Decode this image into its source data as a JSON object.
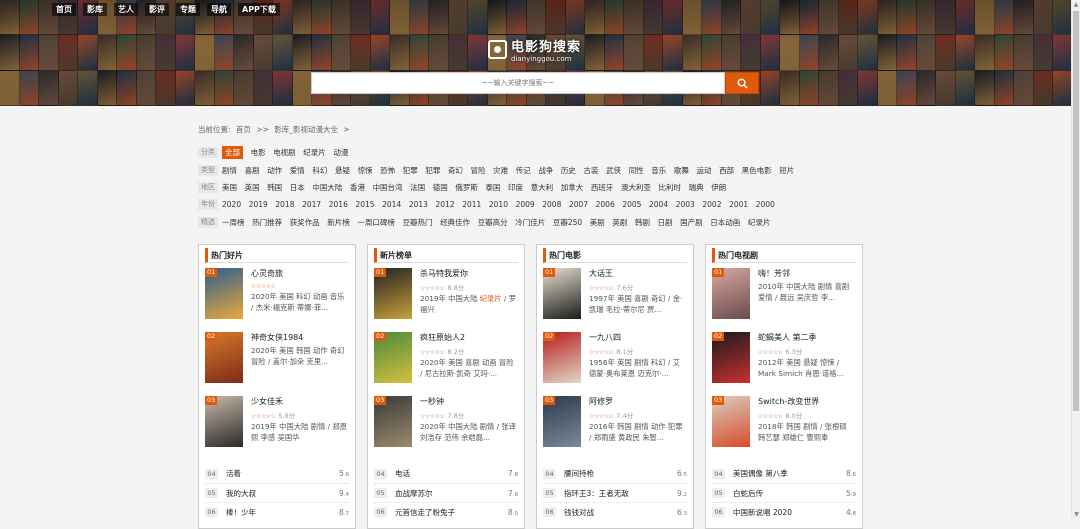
{
  "nav": [
    "首页",
    "影库",
    "艺人",
    "影评",
    "专题",
    "导航",
    "APP下载"
  ],
  "logo": {
    "title": "电影狗搜索",
    "subtitle": "dianyinggou.com"
  },
  "search": {
    "placeholder": "~~输入关键字搜索~~"
  },
  "colors": {
    "accent": "#e05a0c"
  },
  "breadcrumb": {
    "prefix": "当前位置:",
    "home": "首页",
    "sep1": ">>",
    "section": "影库_影视动漫大全",
    "sep2": ">"
  },
  "filters": [
    {
      "label": "分类",
      "items": [
        "全部",
        "电影",
        "电视剧",
        "纪录片",
        "动漫"
      ],
      "active": 0
    },
    {
      "label": "类型",
      "items": [
        "剧情",
        "喜剧",
        "动作",
        "爱情",
        "科幻",
        "悬疑",
        "惊悚",
        "恐怖",
        "犯罪",
        "犯罪",
        "奇幻",
        "冒险",
        "灾难",
        "传记",
        "战争",
        "历史",
        "古装",
        "武侠",
        "同性",
        "音乐",
        "歌舞",
        "运动",
        "西部",
        "黑色电影",
        "短片"
      ],
      "active": -1
    },
    {
      "label": "地区",
      "items": [
        "美国",
        "英国",
        "韩国",
        "日本",
        "中国大陆",
        "香港",
        "中国台湾",
        "法国",
        "德国",
        "俄罗斯",
        "泰国",
        "印度",
        "意大利",
        "加拿大",
        "西班牙",
        "澳大利亚",
        "比利时",
        "瑞典",
        "伊朗"
      ],
      "active": -1
    },
    {
      "label": "年份",
      "items": [
        "2020",
        "2019",
        "2018",
        "2017",
        "2016",
        "2015",
        "2014",
        "2013",
        "2012",
        "2011",
        "2010",
        "2009",
        "2008",
        "2007",
        "2006",
        "2005",
        "2004",
        "2003",
        "2002",
        "2001",
        "2000"
      ],
      "active": -1
    },
    {
      "label": "精选",
      "items": [
        "一周榜",
        "热门推荐",
        "获奖作品",
        "新片榜",
        "一周口碑榜",
        "豆瓣热门",
        "经典佳作",
        "豆瓣高分",
        "冷门佳片",
        "豆瓣250",
        "美剧",
        "英剧",
        "韩剧",
        "日剧",
        "国产剧",
        "日本动画",
        "纪录片"
      ],
      "active": -1
    }
  ],
  "cards": [
    {
      "title": "热门好片",
      "items": [
        {
          "rank": "01",
          "name": "心灵奇旅",
          "stars": "☆☆☆☆☆",
          "score": "",
          "desc": "2020年 美国 科幻 动画 音乐 / 杰米·福克斯 蒂娜·菲...",
          "highlight": "",
          "colors": [
            "#2d5e8c",
            "#e9a93c"
          ]
        },
        {
          "rank": "02",
          "name": "神奇女侠1984",
          "stars": "",
          "score": "",
          "desc": "2020年 美国 韩国 动作 奇幻 冒险 / 盖尔·加朵 克里...",
          "highlight": "",
          "colors": [
            "#d77a2a",
            "#7d2a1a"
          ]
        },
        {
          "rank": "03",
          "name": "少女佳禾",
          "stars": "☆☆☆☆☆",
          "score": "5.8分",
          "desc": "2019年 中国大陆 剧情 / 郑恩熙 李感 吴国华",
          "highlight": "",
          "colors": [
            "#c8b8a8",
            "#2a2a2a"
          ]
        }
      ],
      "list": [
        {
          "num": "04",
          "name": "活着",
          "score": "5",
          "decimal": ".6"
        },
        {
          "num": "05",
          "name": "我的大叔",
          "score": "9",
          "decimal": ".4"
        },
        {
          "num": "06",
          "name": "棒！少年",
          "score": "8",
          "decimal": ".7"
        }
      ]
    },
    {
      "title": "新片榜单",
      "items": [
        {
          "rank": "01",
          "name": "杀马特我爱你",
          "stars": "☆☆☆☆☆",
          "score": "8.8分",
          "desc": "2019年 中国大陆 ",
          "highlight": "纪录片",
          "desc2": " / 罗福兴",
          "colors": [
            "#222",
            "#c8a13c"
          ]
        },
        {
          "rank": "02",
          "name": "疯狂原始人2",
          "stars": "☆☆☆☆☆",
          "score": "8.2分",
          "desc": "2020年 美国 喜剧 动画 冒险 / 尼古拉斯·凯奇 艾玛·...",
          "highlight": "",
          "colors": [
            "#4a8a3a",
            "#d4c040"
          ]
        },
        {
          "rank": "03",
          "name": "一秒钟",
          "stars": "☆☆☆☆☆",
          "score": "7.8分",
          "desc": "2020年 中国大陆 剧情 / 张译 刘浩存 范伟 余皑磊...",
          "highlight": "",
          "colors": [
            "#3a3a3a",
            "#9a8a6a"
          ]
        }
      ],
      "list": [
        {
          "num": "04",
          "name": "电话",
          "score": "7",
          "decimal": ".8"
        },
        {
          "num": "05",
          "name": "血战摩苏尔",
          "score": "7",
          "decimal": ".8"
        },
        {
          "num": "06",
          "name": "元首信走了粉兔子",
          "score": "8",
          "decimal": ".0"
        }
      ]
    },
    {
      "title": "热门电影",
      "items": [
        {
          "rank": "01",
          "name": "大话王",
          "stars": "☆☆☆☆☆",
          "score": "7.6分",
          "desc": "1997年 美国 喜剧 奇幻 / 金·凯瑞 毛拉·蒂尔尼 贾...",
          "highlight": "",
          "colors": [
            "#e8e0d0",
            "#1a1a1a"
          ]
        },
        {
          "rank": "02",
          "name": "一九八四",
          "stars": "☆☆☆☆☆",
          "score": "8.1分",
          "desc": "1956年 英国 剧情 科幻 / 艾德蒙·奥布莱恩 迈克尔·...",
          "highlight": "",
          "colors": [
            "#b81c1c",
            "#e0d8c8"
          ]
        },
        {
          "rank": "03",
          "name": "阿修罗",
          "stars": "☆☆☆☆☆",
          "score": "7.4分",
          "desc": "2016年 韩国 剧情 动作 犯罪 / 郑雨盛 黄政民 朱智...",
          "highlight": "",
          "colors": [
            "#2a3a4a",
            "#7a8a9a"
          ]
        }
      ],
      "list": [
        {
          "num": "04",
          "name": "腰间持枪",
          "score": "6",
          "decimal": ".5"
        },
        {
          "num": "05",
          "name": "指环王3：王者无敌",
          "score": "9",
          "decimal": ".2"
        },
        {
          "num": "06",
          "name": "钱钱对战",
          "score": "6",
          "decimal": ".3"
        }
      ]
    },
    {
      "title": "热门电视剧",
      "items": [
        {
          "rank": "01",
          "name": "嗨！芳邻",
          "stars": "",
          "score": "",
          "desc": "2010年 中国大陆 剧情 喜剧 爱情 / 聂远 吴庆哲 李...",
          "highlight": "",
          "colors": [
            "#d8a8a0",
            "#6a4a4a"
          ]
        },
        {
          "rank": "02",
          "name": "蛇蝎美人 第二季",
          "stars": "☆☆☆☆☆",
          "score": "6.3分",
          "desc": "2012年 美国 悬疑 惊悚 / Mark Simich 肖恩·道格...",
          "highlight": "",
          "colors": [
            "#1a1a1a",
            "#c83030"
          ]
        },
        {
          "rank": "03",
          "name": "Switch-改变世界",
          "stars": "☆☆☆☆☆",
          "score": "8.0分",
          "desc": "2018年 韩国 剧情 / 张根硕 韩艺瑟 郑雄仁 曹熙奉",
          "highlight": "",
          "colors": [
            "#d8d0c0",
            "#d84a2a"
          ]
        }
      ],
      "list": [
        {
          "num": "04",
          "name": "美国偶像 第八季",
          "score": "8",
          "decimal": ".6"
        },
        {
          "num": "05",
          "name": "白蛇后传",
          "score": "5",
          "decimal": ".9"
        },
        {
          "num": "06",
          "name": "中国新说唱 2020",
          "score": "4",
          "decimal": ".8"
        }
      ]
    }
  ]
}
